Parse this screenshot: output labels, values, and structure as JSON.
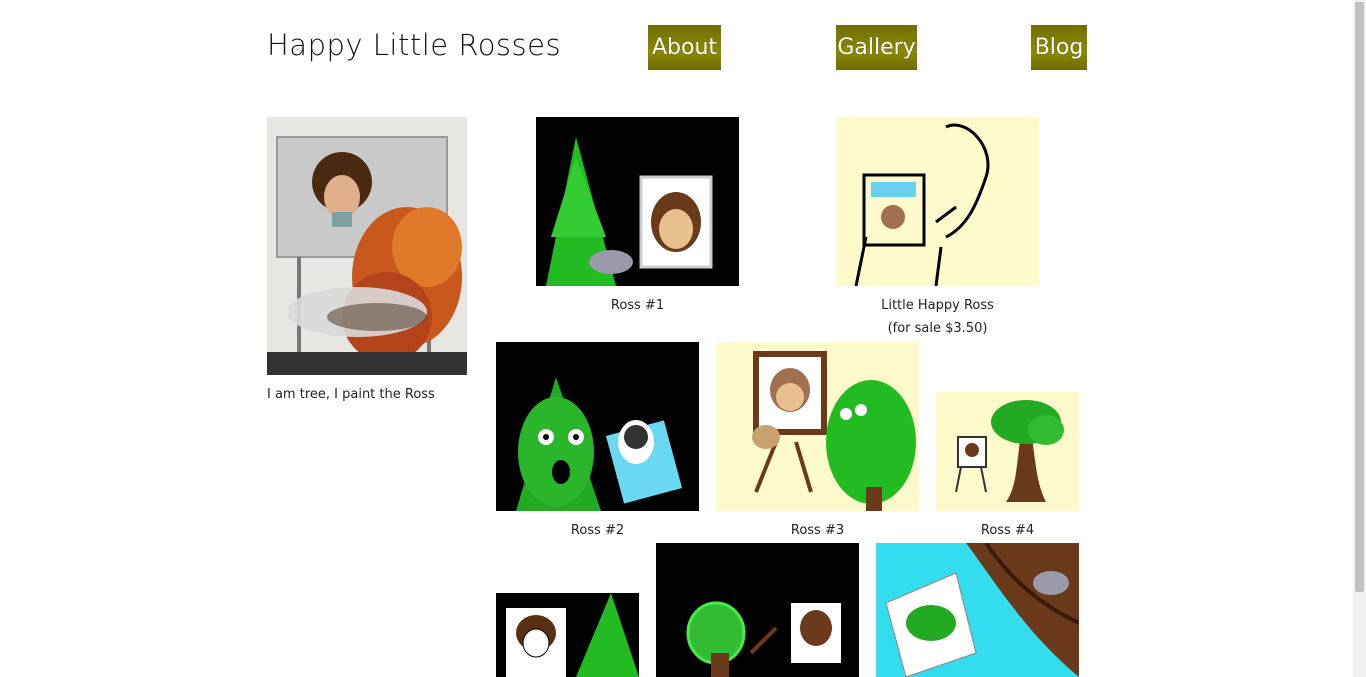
{
  "header": {
    "title": "Happy Little Rosses"
  },
  "nav": {
    "about": "About",
    "gallery": "Gallery",
    "blog": "Blog"
  },
  "sidebar": {
    "caption": "I am tree, I paint the Ross"
  },
  "gallery": {
    "ross1": "Ross #1",
    "little_happy_line1": "Little Happy Ross",
    "little_happy_line2": "(for sale $3.50)",
    "ross2": "Ross #2",
    "ross3": "Ross #3",
    "ross4": "Ross #4"
  },
  "colors": {
    "nav_button": "#808000",
    "cream": "#fffacc",
    "tree_green": "#22bb22"
  }
}
